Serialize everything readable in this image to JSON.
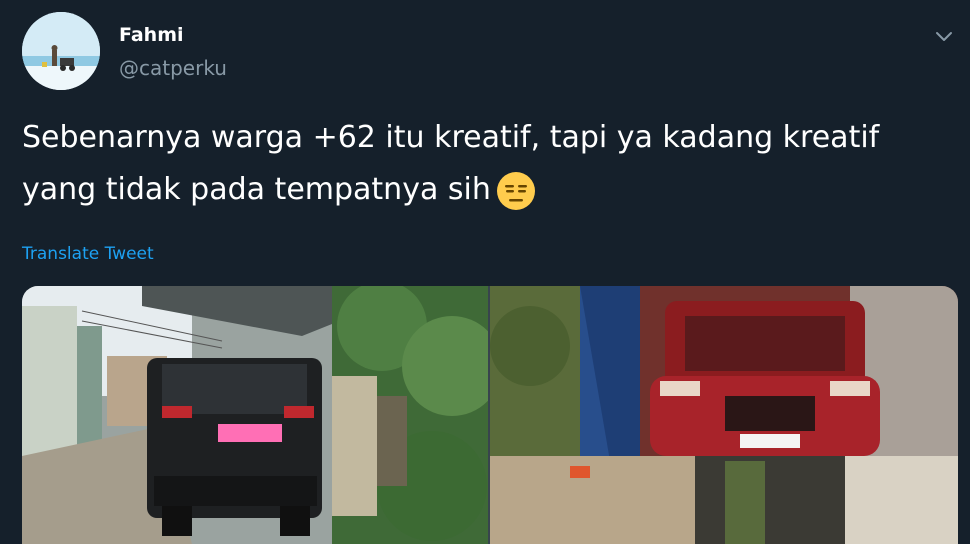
{
  "user": {
    "display_name": "Fahmi",
    "handle": "@catperku",
    "avatar_icon": "avatar-beach-photo"
  },
  "tweet": {
    "text_line1": "Sebenarnya warga +62 itu kreatif, tapi ya kadang kreatif",
    "text_line2": "yang tidak pada tempatnya sih",
    "emoji": "expressionless-face-emoji",
    "translate_label": "Translate Tweet"
  },
  "menu": {
    "icon": "chevron-down-icon"
  },
  "media": {
    "photos": [
      {
        "icon": "photo-suv-parked-under-carport"
      },
      {
        "icon": "photo-red-car-on-raised-driveway"
      }
    ]
  },
  "colors": {
    "background": "#15202b",
    "text": "#ffffff",
    "secondary_text": "#8899a6",
    "link": "#1da1f2"
  }
}
